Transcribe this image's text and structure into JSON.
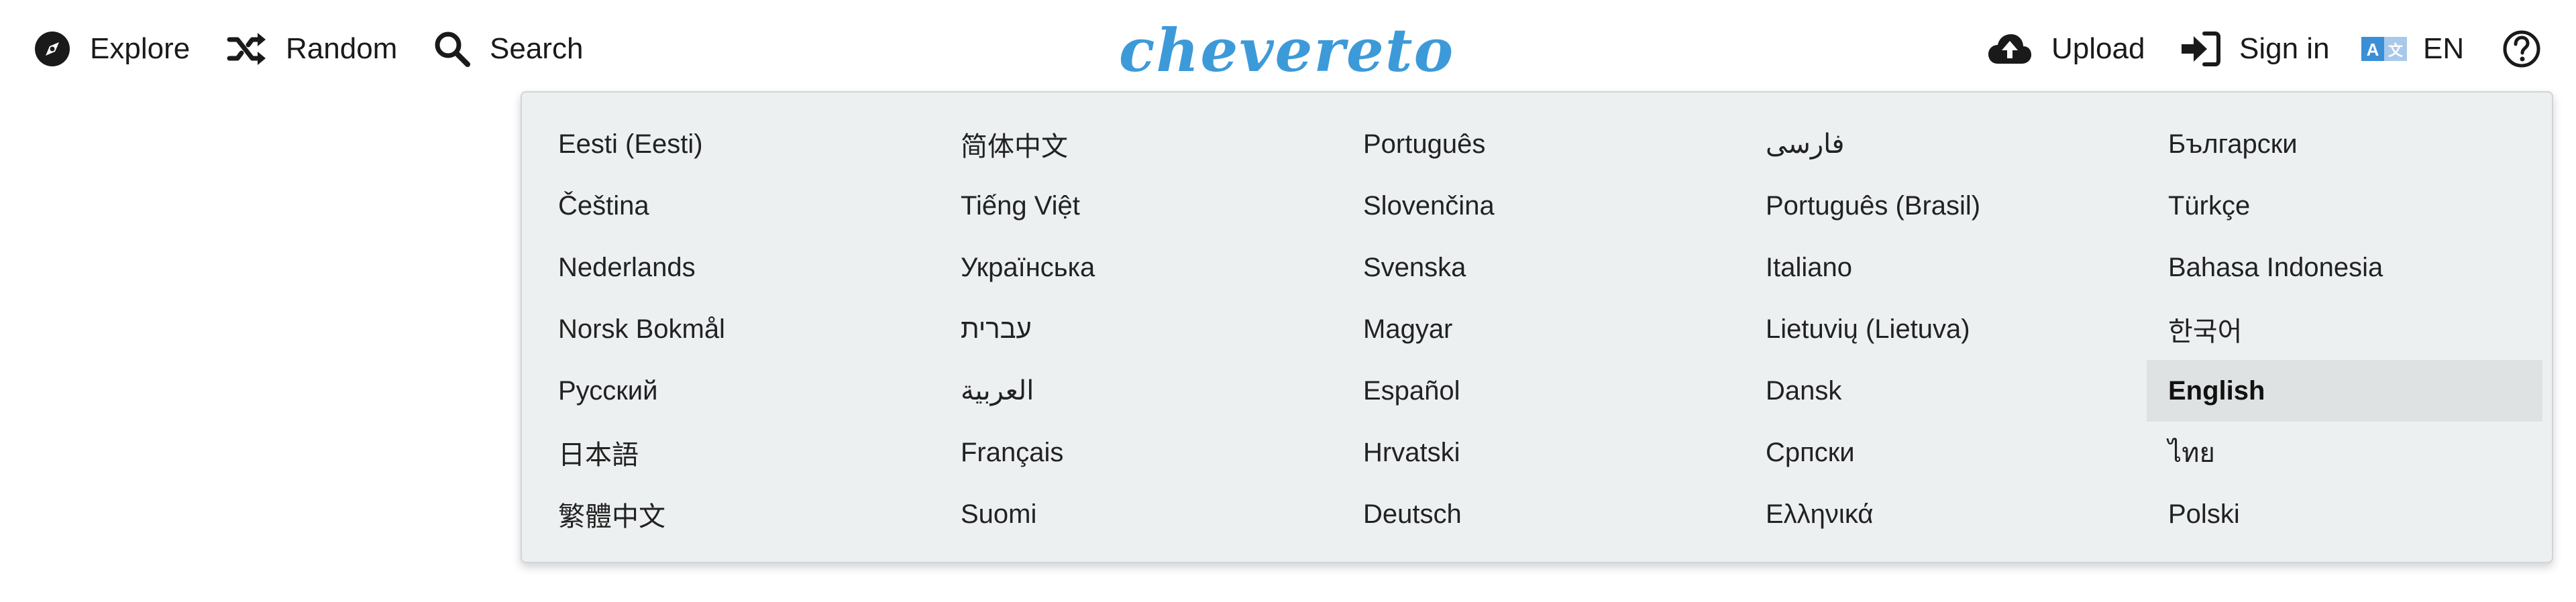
{
  "nav": {
    "explore": "Explore",
    "random": "Random",
    "search": "Search",
    "upload": "Upload",
    "sign_in": "Sign in",
    "language_code": "EN"
  },
  "logo": "chevereto",
  "colors": {
    "brand": "#3d9ad9",
    "dropdown_bg": "#edf0f1",
    "active_bg": "#dfe2e3",
    "lang_icon_blue": "#3b8fd6"
  },
  "icons": [
    "compass-icon",
    "shuffle-icon",
    "search-icon",
    "cloud-upload-icon",
    "sign-in-icon",
    "language-icon",
    "help-icon"
  ],
  "languages": {
    "columns": [
      [
        "Eesti (Eesti)",
        "Čeština",
        "Nederlands",
        "Norsk Bokmål",
        "Русский",
        "日本語",
        "繁體中文"
      ],
      [
        "简体中文",
        "Tiếng Việt",
        "Українська",
        "עברית",
        "العربية",
        "Français",
        "Suomi"
      ],
      [
        "Português",
        "Slovenčina",
        "Svenska",
        "Magyar",
        "Español",
        "Hrvatski",
        "Deutsch"
      ],
      [
        "فارسی",
        "Português (Brasil)",
        "Italiano",
        "Lietuvių (Lietuva)",
        "Dansk",
        "Српски",
        "Ελληνικά"
      ],
      [
        "Български",
        "Türkçe",
        "Bahasa Indonesia",
        "한국어",
        "English",
        "ไทย",
        "Polski"
      ]
    ],
    "selected": "English"
  }
}
